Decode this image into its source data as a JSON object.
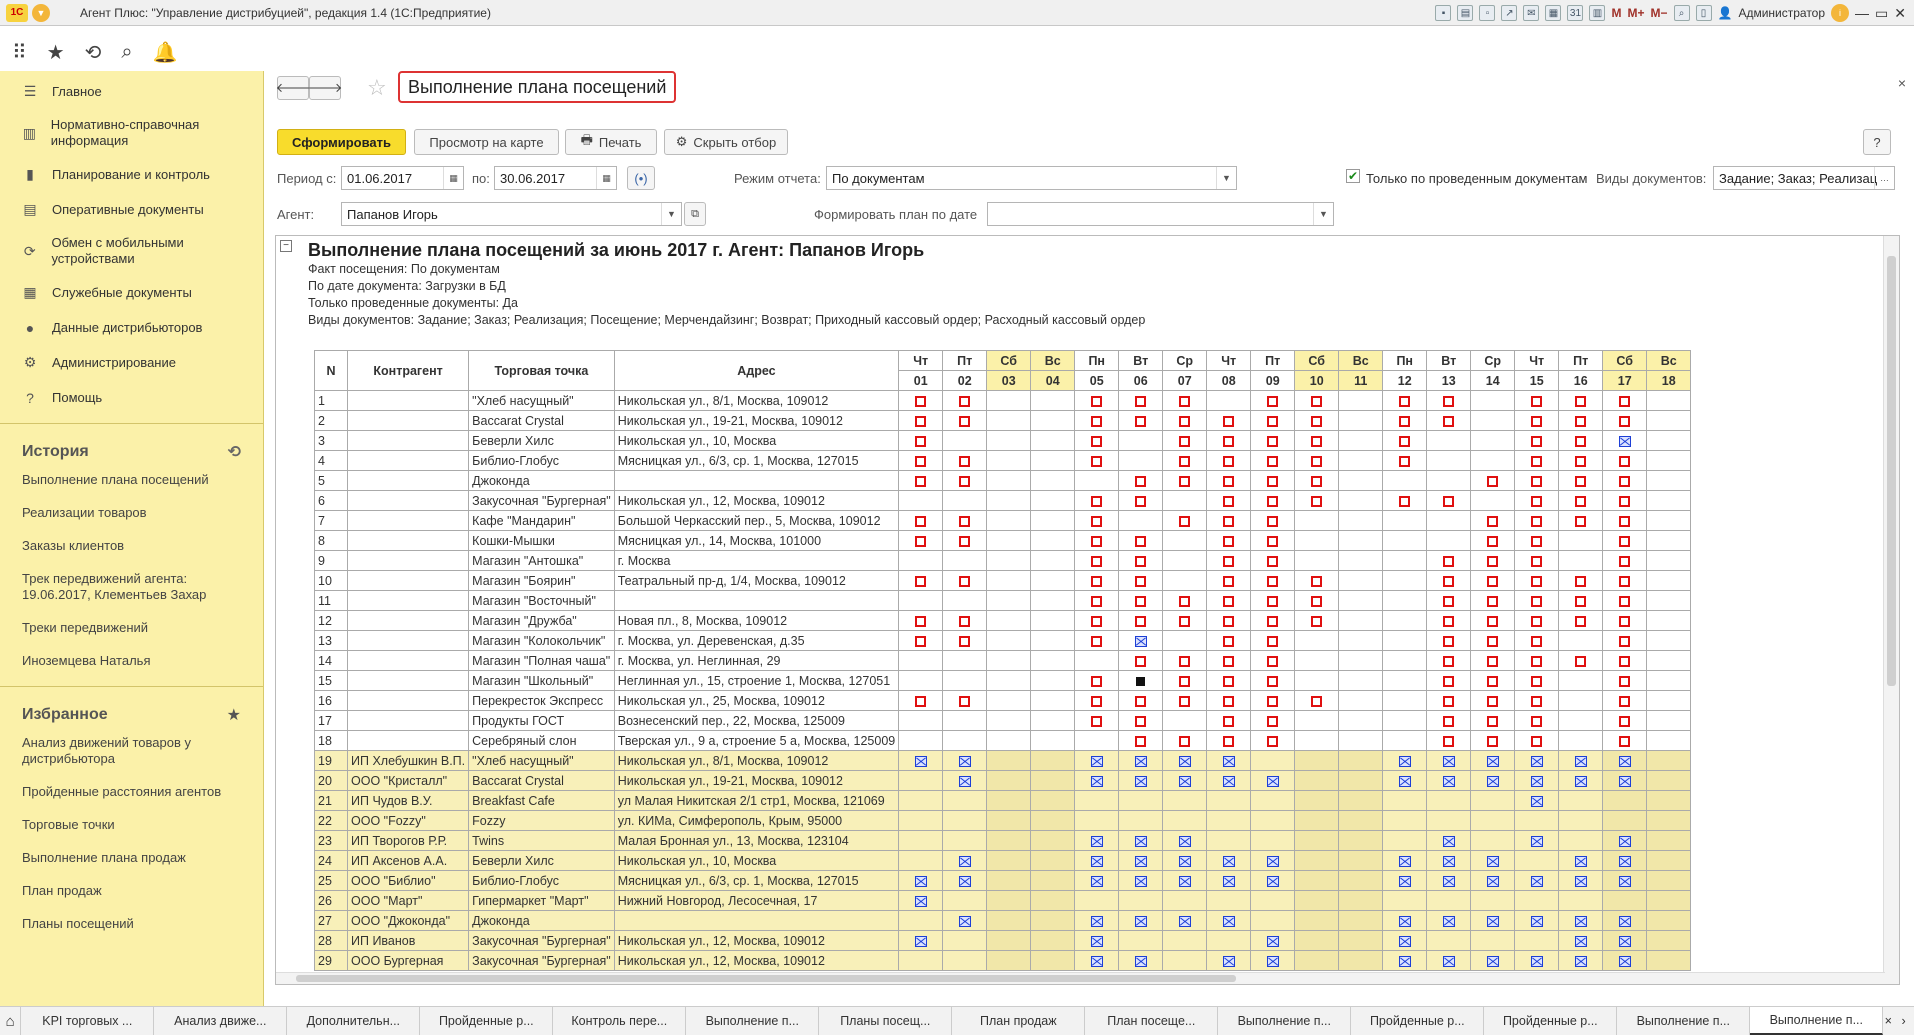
{
  "window": {
    "title": "Агент Плюс: \"Управление дистрибуцией\", редакция 1.4  (1С:Предприятие)",
    "user": "Администратор"
  },
  "nav": {
    "items": [
      {
        "label": "Главное",
        "icon": "menu-icon"
      },
      {
        "label": "Нормативно-справочная информация",
        "icon": "book-icon"
      },
      {
        "label": "Планирование и контроль",
        "icon": "chart-icon"
      },
      {
        "label": "Оперативные документы",
        "icon": "document-icon"
      },
      {
        "label": "Обмен с мобильными устройствами",
        "icon": "sync-icon"
      },
      {
        "label": "Служебные документы",
        "icon": "list-icon"
      },
      {
        "label": "Данные дистрибьюторов",
        "icon": "people-icon"
      },
      {
        "label": "Администрирование",
        "icon": "gear-icon"
      },
      {
        "label": "Помощь",
        "icon": "help-icon"
      }
    ]
  },
  "history": {
    "title": "История",
    "items": [
      "Выполнение плана посещений",
      "Реализации товаров",
      "Заказы клиентов",
      "Трек передвижений агента: 19.06.2017, Клементьев Захар",
      "Треки передвижений",
      "Иноземцева Наталья"
    ]
  },
  "favorites": {
    "title": "Избранное",
    "items": [
      "Анализ движений товаров у дистрибьютора",
      "Пройденные расстояния агентов",
      "Торговые точки",
      "Выполнение плана продаж",
      "План продаж",
      "Планы посещений"
    ]
  },
  "form": {
    "title": "Выполнение плана посещений",
    "btn_generate": "Сформировать",
    "btn_map": "Просмотр на карте",
    "btn_print": "Печать",
    "btn_hide": "Скрыть отбор",
    "help": "?",
    "period_label": "Период с:",
    "date_from": "01.06.2017",
    "to_label": "по:",
    "date_to": "30.06.2017",
    "mode_label": "Режим отчета:",
    "mode_value": "По документам",
    "only_posted": "Только по проведенным документам",
    "doc_types_label": "Виды документов:",
    "doc_types_value": "Задание; Заказ; Реализац",
    "agent_label": "Агент:",
    "agent_value": "Папанов Игорь",
    "plan_by_date_label": "Формировать план по дате",
    "plan_by_date_value": ""
  },
  "report": {
    "title": "Выполнение плана посещений за июнь 2017 г.   Агент: Папанов Игорь",
    "lines": [
      "Факт посещения: По документам",
      "По дате документа: Загрузки в БД",
      "Только проведенные документы: Да",
      "Виды документов: Задание; Заказ; Реализация; Посещение; Мерчендайзинг; Возврат; Приходный кассовый ордер; Расходный кассовый ордер"
    ],
    "col_n": "N",
    "col_contractor": "Контрагент",
    "col_point": "Торговая точка",
    "col_address": "Адрес",
    "days": [
      {
        "wd": "Чт",
        "d": "01"
      },
      {
        "wd": "Пт",
        "d": "02"
      },
      {
        "wd": "Сб",
        "d": "03"
      },
      {
        "wd": "Вс",
        "d": "04"
      },
      {
        "wd": "Пн",
        "d": "05"
      },
      {
        "wd": "Вт",
        "d": "06"
      },
      {
        "wd": "Ср",
        "d": "07"
      },
      {
        "wd": "Чт",
        "d": "08"
      },
      {
        "wd": "Пт",
        "d": "09"
      },
      {
        "wd": "Сб",
        "d": "10"
      },
      {
        "wd": "Вс",
        "d": "11"
      },
      {
        "wd": "Пн",
        "d": "12"
      },
      {
        "wd": "Вт",
        "d": "13"
      },
      {
        "wd": "Ср",
        "d": "14"
      },
      {
        "wd": "Чт",
        "d": "15"
      },
      {
        "wd": "Пт",
        "d": "16"
      },
      {
        "wd": "Сб",
        "d": "17"
      },
      {
        "wd": "Вс",
        "d": "18"
      }
    ],
    "rows": [
      {
        "n": "1",
        "c": "",
        "p": "\"Хлеб насущный\"",
        "a": "Никольская ул., 8/1, Москва, 109012",
        "m": "110011101101101110",
        "y": 0
      },
      {
        "n": "2",
        "c": "",
        "p": "Baccarat Crystal",
        "a": "Никольская ул., 19-21, Москва, 109012",
        "m": "110011111101101110",
        "y": 0
      },
      {
        "n": "3",
        "c": "",
        "p": "Беверли Хилс",
        "a": "Никольская ул., 10, Москва",
        "m": "100010111101001120",
        "y": 0
      },
      {
        "n": "4",
        "c": "",
        "p": "Библио-Глобус",
        "a": "Мясницкая ул., 6/3, ср. 1, Москва, 127015",
        "m": "110010111101001110",
        "y": 0
      },
      {
        "n": "5",
        "c": "",
        "p": "Джоконда",
        "a": "",
        "m": "110001111100011110",
        "y": 0
      },
      {
        "n": "6",
        "c": "",
        "p": "Закусочная \"Бургерная\"",
        "a": "Никольская ул., 12, Москва, 109012",
        "m": "000011011101101110",
        "y": 0
      },
      {
        "n": "7",
        "c": "",
        "p": "Кафе \"Мандарин\"",
        "a": "Большой Черкасский пер., 5, Москва, 109012",
        "m": "110010111000011110",
        "y": 0
      },
      {
        "n": "8",
        "c": "",
        "p": "Кошки-Мышки",
        "a": "Мясницкая ул., 14, Москва, 101000",
        "m": "110011011000011010",
        "y": 0
      },
      {
        "n": "9",
        "c": "",
        "p": "Магазин \"Антошка\"",
        "a": "г. Москва",
        "m": "000011011000111010",
        "y": 0
      },
      {
        "n": "10",
        "c": "",
        "p": "Магазин \"Боярин\"",
        "a": "Театральный пр-д, 1/4, Москва, 109012",
        "m": "110011011100111110",
        "y": 0
      },
      {
        "n": "11",
        "c": "",
        "p": "Магазин \"Восточный\"",
        "a": "",
        "m": "000011111100111110",
        "y": 0
      },
      {
        "n": "12",
        "c": "",
        "p": "Магазин \"Дружба\"",
        "a": "Новая пл., 8, Москва, 109012",
        "m": "110011111100111110",
        "y": 0
      },
      {
        "n": "13",
        "c": "",
        "p": "Магазин \"Колокольчик\"",
        "a": "г. Москва, ул. Деревенская, д.35",
        "m": "110012011000111010",
        "y": 0
      },
      {
        "n": "14",
        "c": "",
        "p": "Магазин \"Полная чаша\"",
        "a": "г. Москва, ул. Неглинная, 29",
        "m": "000001111000111110",
        "y": 0
      },
      {
        "n": "15",
        "c": "",
        "p": "Магазин \"Школьный\"",
        "a": "Неглинная ул., 15, строение 1, Москва, 127051",
        "m": "000013111000111010",
        "y": 0
      },
      {
        "n": "16",
        "c": "",
        "p": "Перекресток Экспресс",
        "a": "Никольская ул., 25, Москва, 109012",
        "m": "110011111100111010",
        "y": 0
      },
      {
        "n": "17",
        "c": "",
        "p": "Продукты ГОСТ",
        "a": "Вознесенский пер., 22, Москва, 125009",
        "m": "000011011000111010",
        "y": 0
      },
      {
        "n": "18",
        "c": "",
        "p": "Серебряный слон",
        "a": "Тверская ул., 9 а, строение 5 а, Москва, 125009",
        "m": "000001111000111010",
        "y": 0
      },
      {
        "n": "19",
        "c": "ИП Хлебушкин В.П.",
        "p": "\"Хлеб насущный\"",
        "a": "Никольская ул., 8/1, Москва, 109012",
        "m": "220022220002222220",
        "y": 1
      },
      {
        "n": "20",
        "c": "ООО \"Кристалл\"",
        "p": "Baccarat Crystal",
        "a": "Никольская ул., 19-21, Москва, 109012",
        "m": "020022222002222220",
        "y": 1
      },
      {
        "n": "21",
        "c": "ИП Чудов В.У.",
        "p": "Breakfast Cafe",
        "a": "ул Малая Никитская 2/1 стр1, Москва, 121069",
        "m": "000000000000002000",
        "y": 1
      },
      {
        "n": "22",
        "c": "ООО \"Fozzy\"",
        "p": "Fozzy",
        "a": " ул. КИМа, Симферополь, Крым, 95000",
        "m": "000000000000000000",
        "y": 1
      },
      {
        "n": "23",
        "c": "ИП Творогов Р.Р.",
        "p": "Twins",
        "a": "Малая Бронная ул., 13, Москва, 123104",
        "m": "000022200000202020",
        "y": 1
      },
      {
        "n": "24",
        "c": "ИП Аксенов А.А.",
        "p": "Беверли Хилс",
        "a": "Никольская ул., 10, Москва",
        "m": "020022222002220220",
        "y": 1
      },
      {
        "n": "25",
        "c": "ООО \"Библио\"",
        "p": "Библио-Глобус",
        "a": "Мясницкая ул., 6/3, ср. 1, Москва, 127015",
        "m": "220022222002222220",
        "y": 1
      },
      {
        "n": "26",
        "c": "ООО \"Март\"",
        "p": "Гипермаркет \"Март\"",
        "a": "Нижний Новгород, Лесосечная, 17",
        "m": "200000000000000000",
        "y": 1
      },
      {
        "n": "27",
        "c": "ООО \"Джоконда\"",
        "p": "Джоконда",
        "a": "",
        "m": "020022220002222220",
        "y": 1
      },
      {
        "n": "28",
        "c": "ИП Иванов",
        "p": "Закусочная \"Бургерная\"",
        "a": "Никольская ул., 12, Москва, 109012",
        "m": "200020002002000220",
        "y": 1
      },
      {
        "n": "29",
        "c": "ООО Бургерная",
        "p": "Закусочная \"Бургерная\"",
        "a": "Никольская ул., 12, Москва, 109012",
        "m": "000022022002222220",
        "y": 1
      }
    ]
  },
  "tabs": [
    "KPI торговых ...",
    "Анализ движе...",
    "Дополнительн...",
    "Пройденные р...",
    "Контроль пере...",
    "Выполнение п...",
    "Планы посещ...",
    "План продаж",
    "План посеще...",
    "Выполнение п...",
    "Пройденные р...",
    "Пройденные р...",
    "Выполнение п...",
    "Выполнение п..."
  ]
}
